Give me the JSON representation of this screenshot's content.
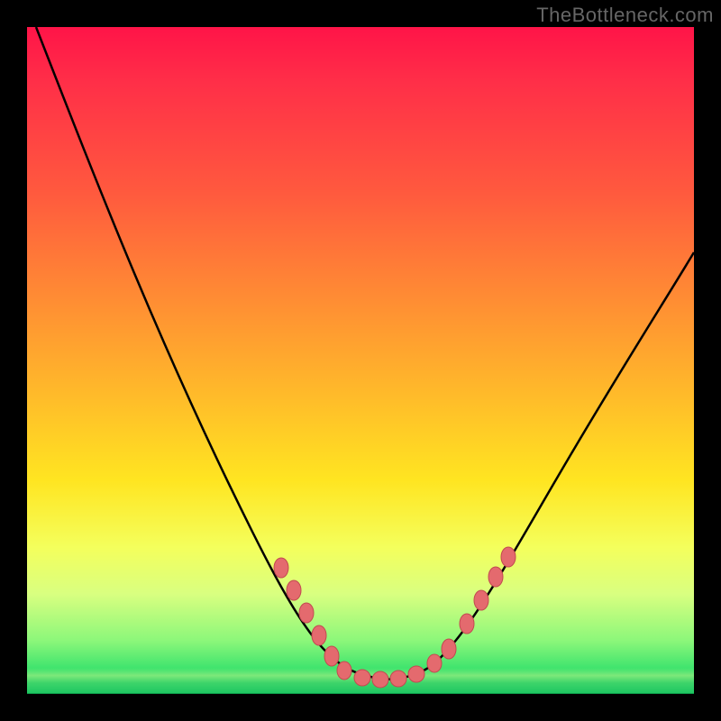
{
  "watermark": "TheBottleneck.com",
  "colors": {
    "frame": "#000000",
    "curve_stroke": "#000000",
    "marker_fill": "#e46a6e",
    "marker_stroke": "#c24a50"
  },
  "chart_data": {
    "type": "line",
    "title": "",
    "xlabel": "",
    "ylabel": "",
    "xlim": [
      0,
      100
    ],
    "ylim": [
      0,
      100
    ],
    "x": [
      0,
      5,
      10,
      15,
      20,
      25,
      30,
      35,
      40,
      42,
      44,
      46,
      48,
      50,
      52,
      54,
      56,
      58,
      60,
      62,
      65,
      70,
      75,
      80,
      85,
      90,
      95,
      100
    ],
    "y": [
      100,
      90,
      80,
      70,
      60,
      50,
      40,
      30,
      20,
      14,
      9,
      6,
      4,
      3,
      3,
      3,
      4,
      6,
      9,
      13,
      18,
      26,
      33,
      40,
      47,
      54,
      60,
      66
    ],
    "markers_x": [
      38,
      40,
      42,
      44,
      46,
      50,
      54,
      58,
      60,
      62,
      64,
      66
    ],
    "markers_y": [
      22,
      16,
      12,
      8,
      5,
      3,
      3,
      6,
      9,
      13,
      17,
      22
    ]
  }
}
